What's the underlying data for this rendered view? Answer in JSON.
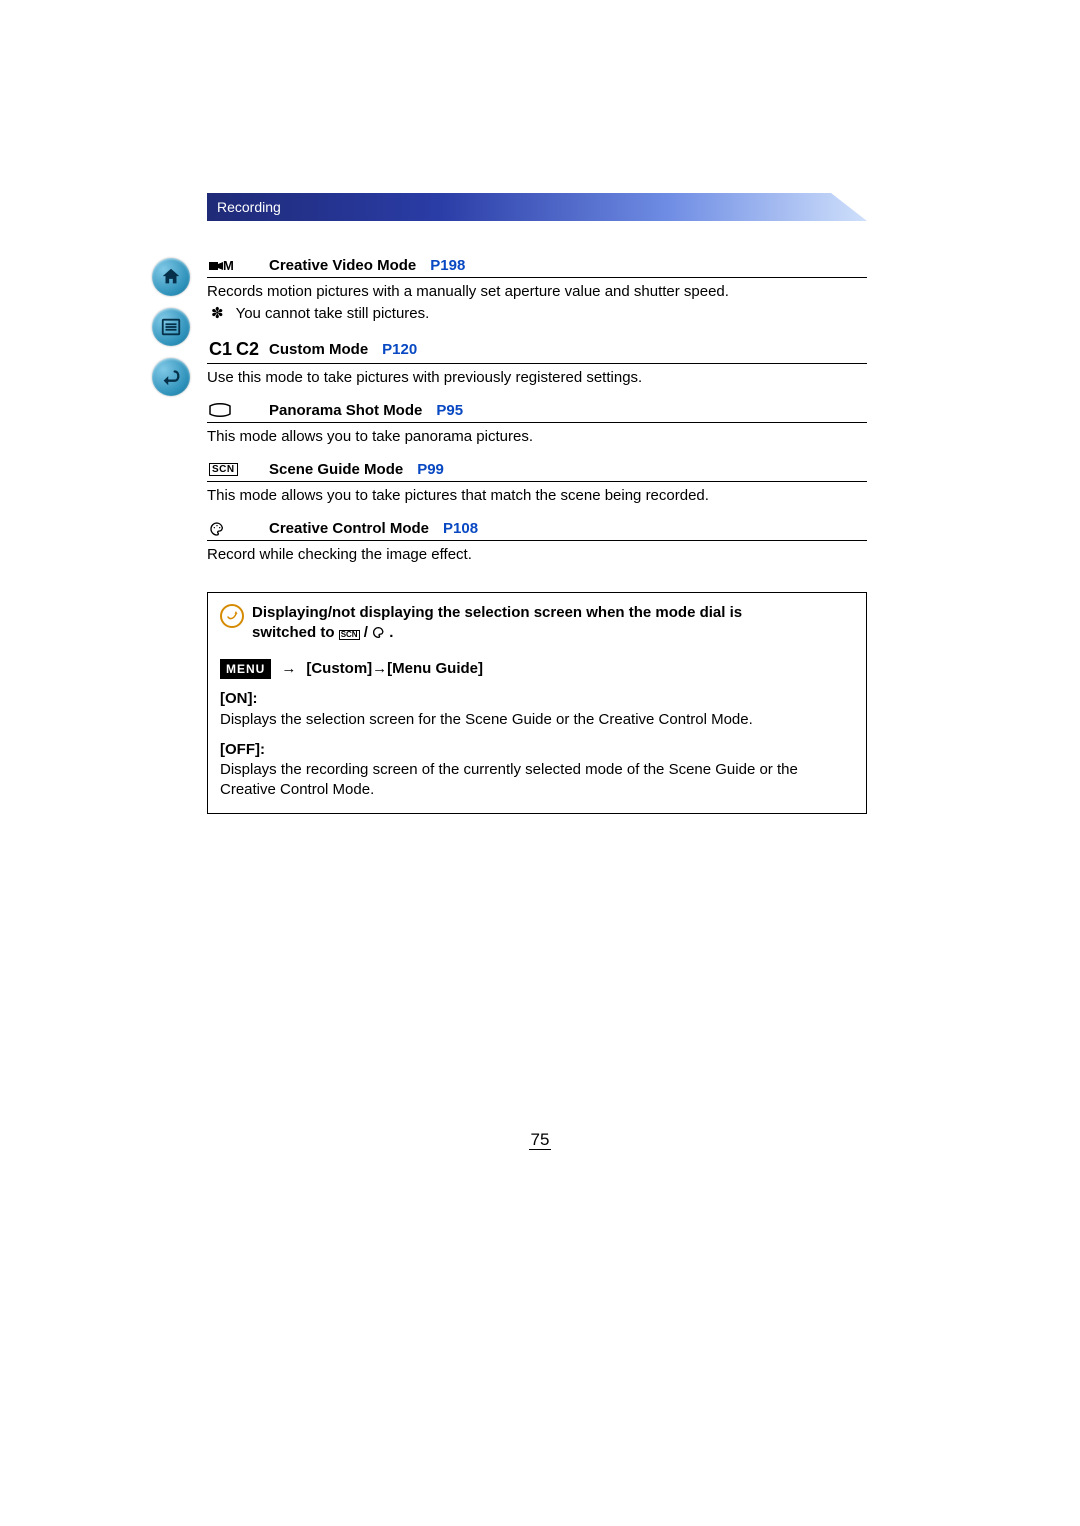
{
  "header": {
    "section": "Recording"
  },
  "modes": [
    {
      "icon": "video-m",
      "title": "Creative Video Mode",
      "pageref": "P198",
      "desc": "Records motion pictures with a manually set aperture value and shutter speed.",
      "note": "You cannot take still pictures."
    },
    {
      "icon": "c1c2",
      "title": "Custom Mode",
      "pageref": "P120",
      "desc": "Use this mode to take pictures with previously registered settings."
    },
    {
      "icon": "panorama",
      "title": "Panorama Shot Mode",
      "pageref": "P95",
      "desc": "This mode allows you to take panorama pictures."
    },
    {
      "icon": "scn",
      "title": "Scene Guide Mode",
      "pageref": "P99",
      "desc": "This mode allows you to take pictures that match the scene being recorded."
    },
    {
      "icon": "palette",
      "title": "Creative Control Mode",
      "pageref": "P108",
      "desc": "Record while checking the image effect."
    }
  ],
  "box": {
    "heading_a": "Displaying/not displaying the selection screen when the mode dial is",
    "heading_b": "switched to ",
    "heading_c": ".",
    "menu_badge": "MENU",
    "arrow": "→",
    "menu_path": "[Custom]→[Menu Guide]",
    "on_label": "[ON]:",
    "on_text": "Displays the selection screen for the Scene Guide or the Creative Control Mode.",
    "off_label": "[OFF]:",
    "off_text": "Displays the recording screen of the currently selected mode of the Scene Guide or the Creative Control Mode."
  },
  "page_number": "75",
  "icons": {
    "c1": "C1",
    "c2": "C2",
    "scn": "SCN",
    "video_m_suffix": "M",
    "asterisk": "✽"
  }
}
